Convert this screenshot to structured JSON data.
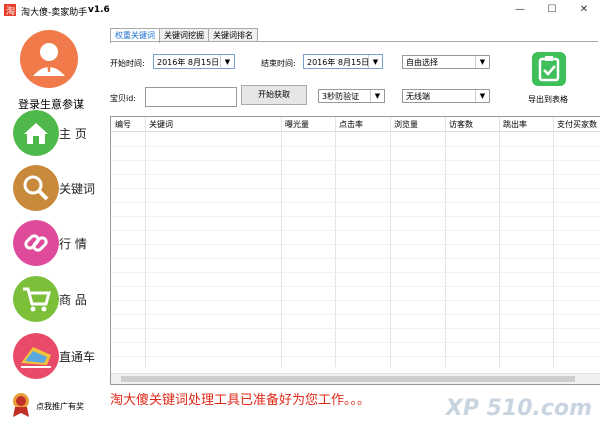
{
  "window": {
    "title": "淘大傻-卖家助手",
    "version": "v1.6",
    "minimize": "—",
    "maximize": "☐",
    "close": "✕"
  },
  "sidebar": {
    "login_label": "登录生意参谋",
    "items": [
      {
        "label": "主 页",
        "icon": "home-icon",
        "color": "#4fb84a"
      },
      {
        "label": "关键词",
        "icon": "search-icon",
        "color": "#c88a3a"
      },
      {
        "label": "行 情",
        "icon": "link-icon",
        "color": "#e04a9a"
      },
      {
        "label": "商 品",
        "icon": "cart-icon",
        "color": "#7cc03a"
      },
      {
        "label": "直通车",
        "icon": "train-icon",
        "color": "#e84a6a"
      }
    ],
    "promo_label": "点我推广有奖"
  },
  "tabs": [
    {
      "label": "权重关键词",
      "active": true
    },
    {
      "label": "关键词挖掘",
      "active": false
    },
    {
      "label": "关键词排名",
      "active": false
    }
  ],
  "filters": {
    "start_label": "开始时间:",
    "start_value": "2016年  8月15日",
    "end_label": "结束时间:",
    "end_value": "2016年  8月15日",
    "mode_select": "自由选择",
    "item_id_label": "宝贝id:",
    "item_id_value": "",
    "start_button": "开始获取",
    "verify_select": "3秒防验证",
    "device_select": "无线端",
    "export_label": "导出到表格"
  },
  "table": {
    "columns": [
      "编号",
      "关键词",
      "曝光量",
      "点击率",
      "浏览量",
      "访客数",
      "跳出率",
      "支付买家数"
    ]
  },
  "status_message": "淘大傻关键词处理工具已准备好为您工作。。。",
  "watermark": "XP 510.com",
  "colors": {
    "accent": "#1a6fd0",
    "status": "#e02a1a",
    "export": "#3fbf5a"
  }
}
